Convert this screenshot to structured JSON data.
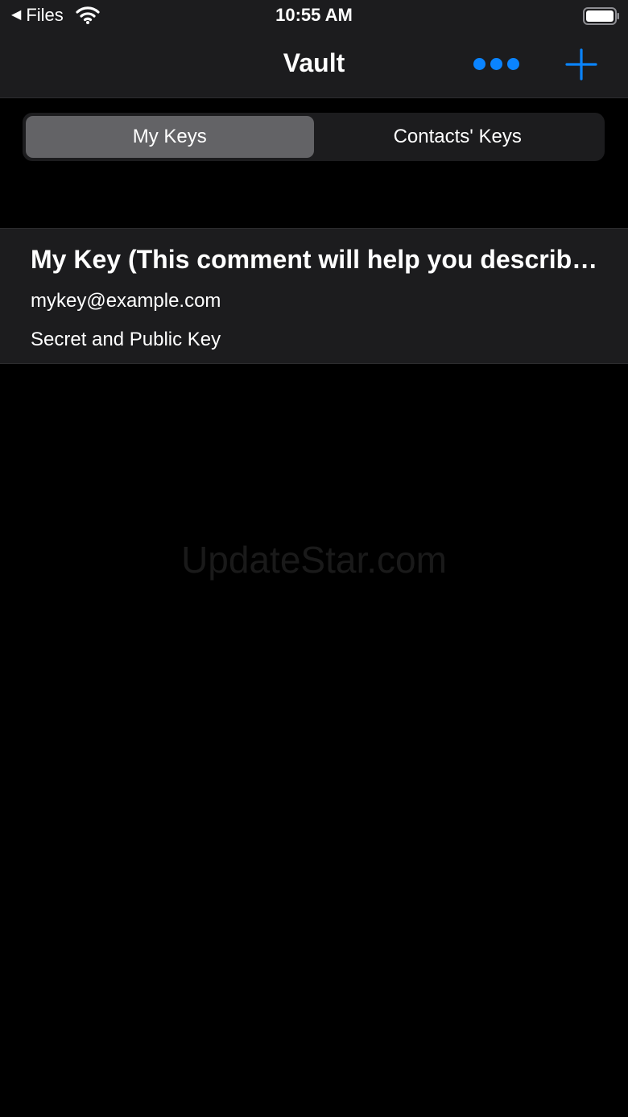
{
  "status_bar": {
    "back_label": "Files",
    "time": "10:55 AM"
  },
  "nav": {
    "title": "Vault"
  },
  "segments": [
    {
      "label": "My Keys",
      "selected": true
    },
    {
      "label": "Contacts' Keys",
      "selected": false
    }
  ],
  "keys": [
    {
      "title": "My Key (This comment will help you describe...",
      "email": "mykey@example.com",
      "type": "Secret and Public Key"
    }
  ],
  "watermark": "UpdateStar.com",
  "colors": {
    "accent": "#0a84ff",
    "bar_background": "#1c1c1e",
    "selected_segment": "#636366",
    "background": "#000000"
  },
  "icons": [
    "back-triangle-icon",
    "wifi-icon",
    "battery-icon",
    "more-icon",
    "plus-icon"
  ]
}
